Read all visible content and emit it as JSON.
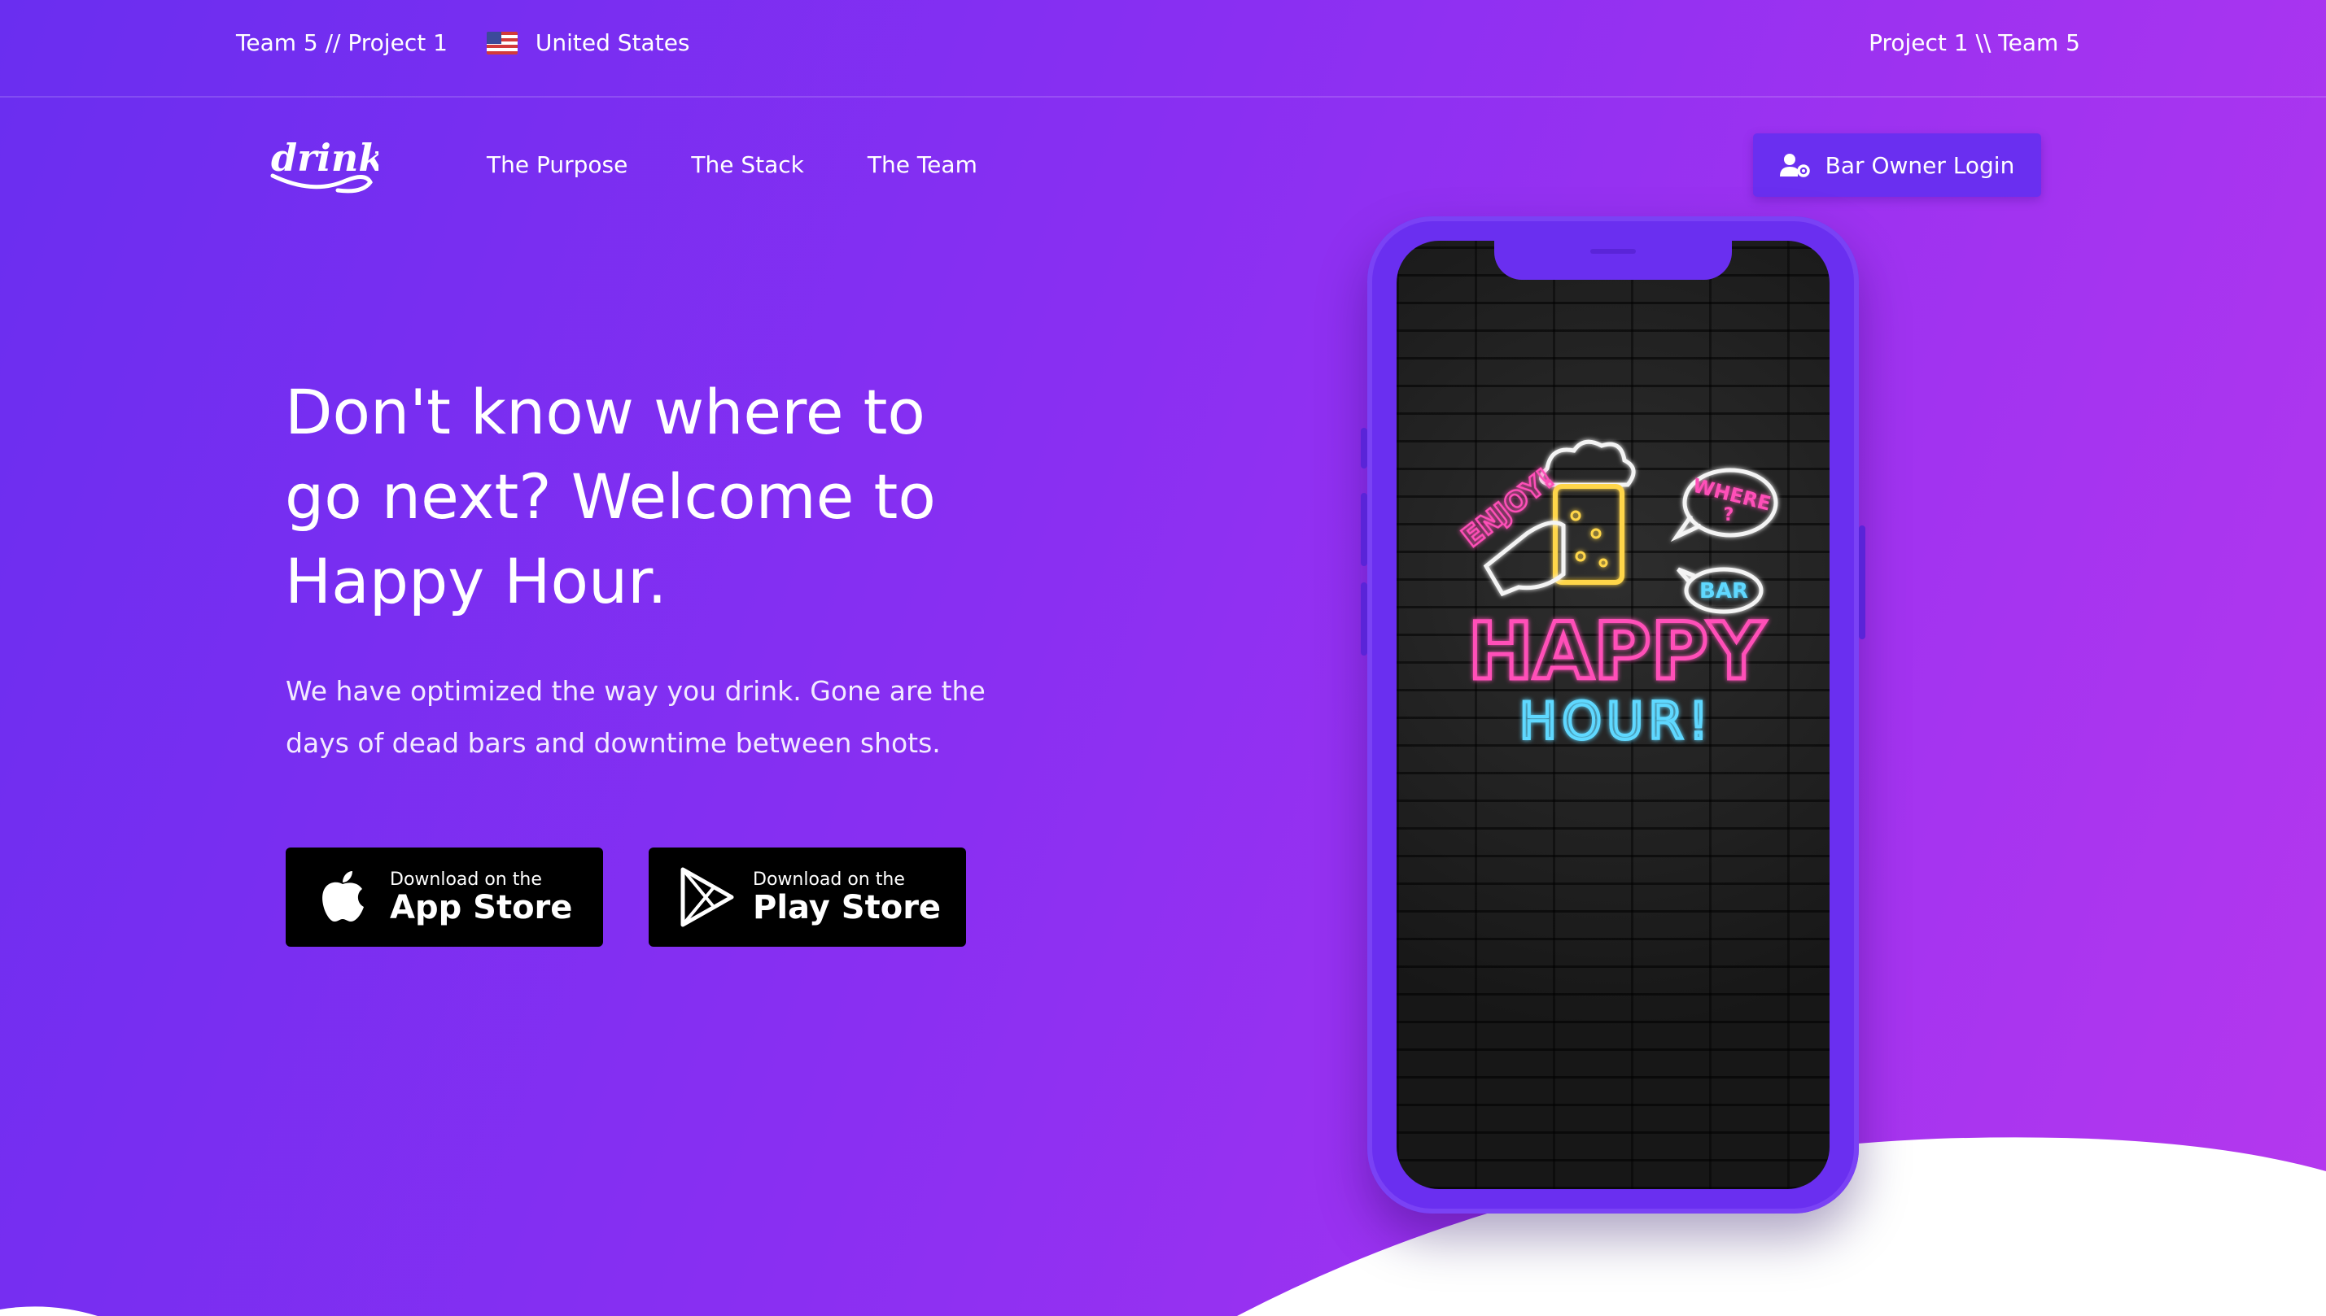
{
  "topbar": {
    "left_text": "Team 5 // Project 1",
    "country": "United States",
    "right_text": "Project 1 \\\\ Team 5"
  },
  "logo": {
    "text": "drinks"
  },
  "nav": {
    "items": [
      {
        "label": "The Purpose"
      },
      {
        "label": "The Stack"
      },
      {
        "label": "The Team"
      }
    ],
    "login_label": "Bar Owner Login"
  },
  "hero": {
    "title": "Don't know where to go next? Welcome to Happy Hour.",
    "subtitle": "We have optimized the way you drink. Gone are the days of dead bars and downtime between shots."
  },
  "stores": {
    "apple": {
      "small": "Download on the",
      "big": "App Store"
    },
    "google": {
      "small": "Download on the",
      "big": "Play Store"
    }
  },
  "phone_sign": {
    "enjoy": "ENJOY!",
    "where": "WHERE",
    "question": "?",
    "bar": "BAR",
    "happy": "HAPPY",
    "hour": "HOUR!"
  },
  "colors": {
    "accent": "#6a2ff0",
    "neon_pink": "#ff4fb8",
    "neon_blue": "#5fd8ff",
    "neon_yellow": "#ffd64a"
  }
}
